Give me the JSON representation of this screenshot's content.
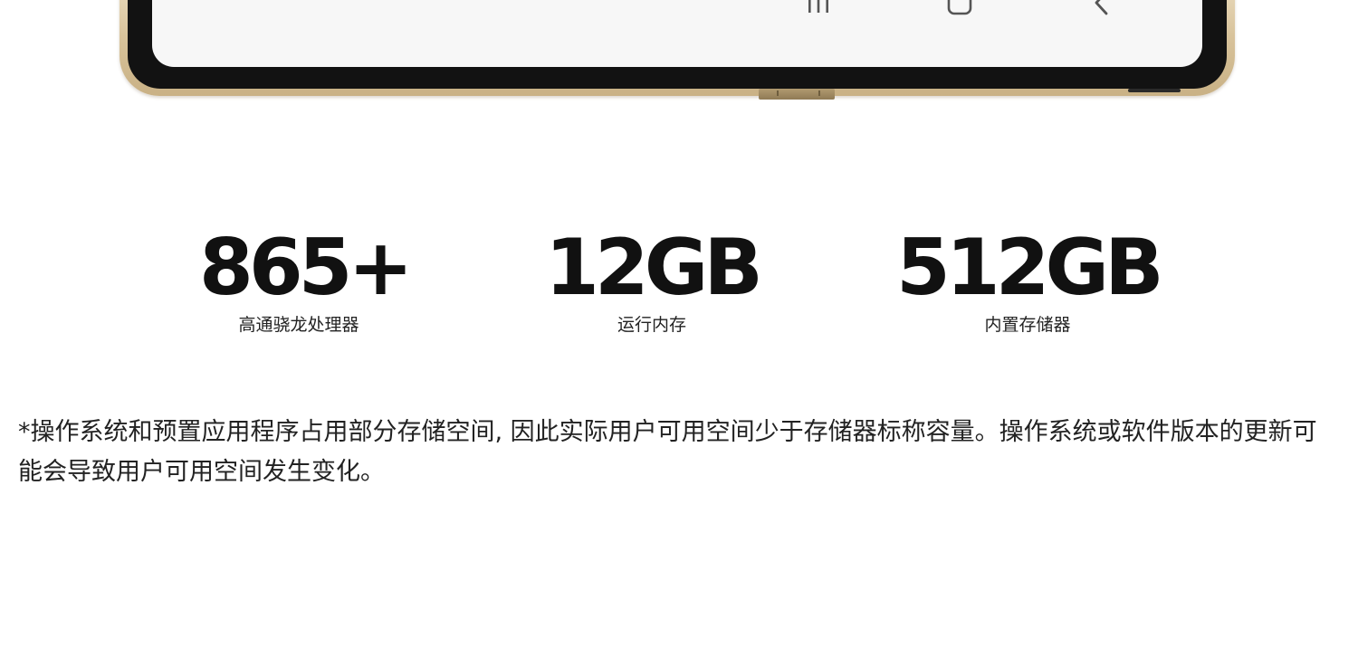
{
  "phone": {
    "nav_buttons": [
      {
        "icon": "recents-icon"
      },
      {
        "icon": "home-icon"
      },
      {
        "icon": "back-icon"
      }
    ],
    "frame_color": "#d8c39b",
    "screen_color": "#f7f7f7"
  },
  "specs": [
    {
      "value": "865+",
      "label": "高通骁龙处理器"
    },
    {
      "value": "12GB",
      "label": "运行内存"
    },
    {
      "value": "512GB",
      "label": "内置存储器"
    }
  ],
  "footnote": "*操作系统和预置应用程序占用部分存储空间, 因此实际用户可用空间少于存储器标称容量。操作系统或软件版本的更新可能会导致用户可用空间发生变化。"
}
